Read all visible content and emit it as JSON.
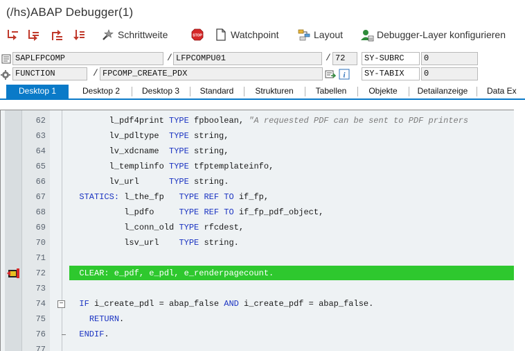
{
  "window": {
    "title": "(/hs)ABAP Debugger(1)"
  },
  "toolbar": {
    "items": [
      {
        "icon": "step-into-icon",
        "label": ""
      },
      {
        "icon": "step-over-icon",
        "label": ""
      },
      {
        "icon": "step-return-icon",
        "label": ""
      },
      {
        "icon": "continue-icon",
        "label": ""
      },
      {
        "icon": "breakpoint-wizard-icon",
        "label": "Schrittweite"
      },
      {
        "icon": "stop-icon",
        "label": ""
      },
      {
        "icon": "document-icon",
        "label": "Watchpoint"
      },
      {
        "icon": "layout-icon",
        "label": "Layout"
      },
      {
        "icon": "user-layer-icon",
        "label": "Debugger-Layer  konfigurieren"
      }
    ]
  },
  "info": {
    "program": "SAPLFPCOMP",
    "include": "LFPCOMPU01",
    "line": "72",
    "var1_name": "SY-SUBRC",
    "var1_value": "0",
    "type": "FUNCTION",
    "name": "FPCOMP_CREATE_PDX",
    "var2_name": "SY-TABIX",
    "var2_value": "0",
    "separator": "/"
  },
  "tabs": [
    "Desktop 1",
    "Desktop 2",
    "Desktop 3",
    "Standard",
    "Strukturen",
    "Tabellen",
    "Objekte",
    "Detailanzeige",
    "Data Ex"
  ],
  "colors": {
    "accent": "#0a7ac8",
    "current_line": "#2ec82e",
    "keyword": "#1a33c2"
  },
  "editor": {
    "current_line": "72",
    "lines": [
      {
        "n": "62",
        "segs": [
          [
            "        l_pdf4print ",
            ""
          ],
          [
            "TYPE",
            "kw"
          ],
          [
            " fpboolean, ",
            ""
          ],
          [
            "\"A requested PDF can be sent to PDF printers",
            "cmt"
          ]
        ]
      },
      {
        "n": "63",
        "segs": [
          [
            "        lv_pdltype  ",
            ""
          ],
          [
            "TYPE",
            "kw"
          ],
          [
            " string,",
            ""
          ]
        ]
      },
      {
        "n": "64",
        "segs": [
          [
            "        lv_xdcname  ",
            ""
          ],
          [
            "TYPE",
            "kw"
          ],
          [
            " string,",
            ""
          ]
        ]
      },
      {
        "n": "65",
        "segs": [
          [
            "        l_templinfo ",
            ""
          ],
          [
            "TYPE",
            "kw"
          ],
          [
            " tfptemplateinfo,",
            ""
          ]
        ]
      },
      {
        "n": "66",
        "segs": [
          [
            "        lv_url      ",
            ""
          ],
          [
            "TYPE",
            "kw"
          ],
          [
            " string.",
            ""
          ]
        ]
      },
      {
        "n": "67",
        "segs": [
          [
            "  ",
            ""
          ],
          [
            "STATICS:",
            "kw"
          ],
          [
            " l_the_fp   ",
            ""
          ],
          [
            "TYPE REF TO",
            "kw"
          ],
          [
            " if_fp,",
            ""
          ]
        ]
      },
      {
        "n": "68",
        "segs": [
          [
            "           l_pdfo     ",
            ""
          ],
          [
            "TYPE REF TO",
            "kw"
          ],
          [
            " if_fp_pdf_object,",
            ""
          ]
        ]
      },
      {
        "n": "69",
        "segs": [
          [
            "           l_conn_old ",
            ""
          ],
          [
            "TYPE",
            "kw"
          ],
          [
            " rfcdest,",
            ""
          ]
        ]
      },
      {
        "n": "70",
        "segs": [
          [
            "           lsv_url    ",
            ""
          ],
          [
            "TYPE",
            "kw"
          ],
          [
            " string.",
            ""
          ]
        ]
      },
      {
        "n": "71",
        "segs": []
      },
      {
        "n": "72",
        "segs": [
          [
            "  CLEAR: e_pdf, e_pdl, e_renderpagecount.",
            "hl"
          ]
        ]
      },
      {
        "n": "73",
        "segs": []
      },
      {
        "n": "74",
        "segs": [
          [
            "  ",
            ""
          ],
          [
            "IF",
            "kw"
          ],
          [
            " i_create_pdl = abap_false ",
            ""
          ],
          [
            "AND",
            "kw"
          ],
          [
            " i_create_pdf = abap_false.",
            ""
          ]
        ]
      },
      {
        "n": "75",
        "segs": [
          [
            "    ",
            ""
          ],
          [
            "RETURN",
            "kw"
          ],
          [
            ".",
            ""
          ]
        ]
      },
      {
        "n": "76",
        "segs": [
          [
            "  ",
            ""
          ],
          [
            "ENDIF",
            "kw"
          ],
          [
            ".",
            ""
          ]
        ]
      },
      {
        "n": "77",
        "segs": []
      }
    ]
  }
}
